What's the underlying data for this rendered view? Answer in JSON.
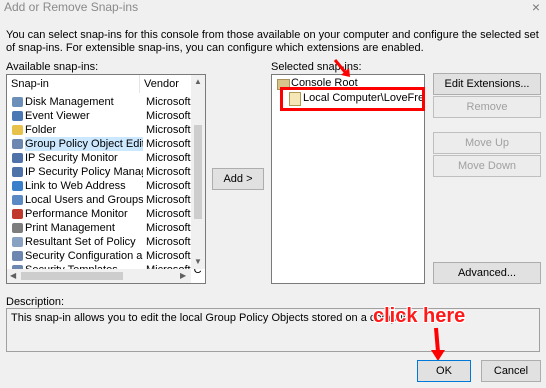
{
  "window": {
    "title": "Add or Remove Snap-ins",
    "close_glyph": "×"
  },
  "intro": "You can select snap-ins for this console from those available on your computer and configure the selected set of snap-ins. For extensible snap-ins, you can configure which extensions are enabled.",
  "available": {
    "label": "Available snap-ins:",
    "col_snapin": "Snap-in",
    "col_vendor": "Vendor",
    "items": [
      {
        "name": "Disk Management",
        "vendor": "Microsoft and",
        "icon": "disk-icon",
        "color": "#6b8fb8"
      },
      {
        "name": "Event Viewer",
        "vendor": "Microsoft Cor",
        "icon": "event-viewer-icon",
        "color": "#4a78b5"
      },
      {
        "name": "Folder",
        "vendor": "Microsoft Cor",
        "icon": "folder-icon",
        "color": "#e8c14a"
      },
      {
        "name": "Group Policy Object Editor",
        "vendor": "Microsoft Cor",
        "icon": "policy-icon",
        "color": "#6d88b0",
        "selected": true
      },
      {
        "name": "IP Security Monitor",
        "vendor": "Microsoft Cor",
        "icon": "security-monitor-icon",
        "color": "#4f72a8"
      },
      {
        "name": "IP Security Policy Manag...",
        "vendor": "Microsoft Cor",
        "icon": "security-policy-icon",
        "color": "#4f72a8"
      },
      {
        "name": "Link to Web Address",
        "vendor": "Microsoft Cor",
        "icon": "web-link-icon",
        "color": "#3a7fc9"
      },
      {
        "name": "Local Users and Groups",
        "vendor": "Microsoft Cor",
        "icon": "users-icon",
        "color": "#5a89c4"
      },
      {
        "name": "Performance Monitor",
        "vendor": "Microsoft Cor",
        "icon": "performance-icon",
        "color": "#c0392b"
      },
      {
        "name": "Print Management",
        "vendor": "Microsoft Cor",
        "icon": "printer-icon",
        "color": "#7d7d7d"
      },
      {
        "name": "Resultant Set of Policy",
        "vendor": "Microsoft Cor",
        "icon": "rsop-icon",
        "color": "#8aa2c2"
      },
      {
        "name": "Security Configuration a...",
        "vendor": "Microsoft Cor",
        "icon": "security-config-icon",
        "color": "#6d88b0"
      },
      {
        "name": "Security Templates",
        "vendor": "Microsoft Cor",
        "icon": "templates-icon",
        "color": "#6d88b0"
      }
    ]
  },
  "add_button": "Add >",
  "selected": {
    "label": "Selected snap-ins:",
    "root": "Console Root",
    "child": "Local Computer\\LoveFreesoftw"
  },
  "buttons": {
    "edit_extensions": "Edit Extensions...",
    "remove": "Remove",
    "move_up": "Move Up",
    "move_down": "Move Down",
    "advanced": "Advanced...",
    "ok": "OK",
    "cancel": "Cancel"
  },
  "description": {
    "label": "Description:",
    "text": "This snap-in allows you to edit the local Group Policy Objects stored on a computer."
  },
  "annotation": {
    "text": "click here",
    "color": "#ff0000"
  }
}
